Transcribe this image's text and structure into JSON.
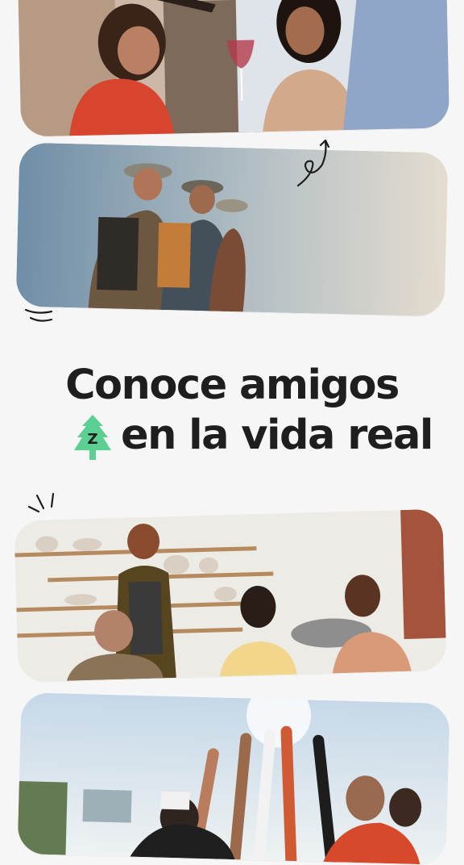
{
  "headline": {
    "line1": "Conoce amigos",
    "line2": "en la vida real",
    "icon": "tree-icon",
    "icon_letter": "Z"
  },
  "colors": {
    "background": "#f6f6f6",
    "text": "#1e1e1e",
    "tree": "#5ccf93"
  },
  "photos": [
    {
      "name": "friends-toasting-wine-photo"
    },
    {
      "name": "hikers-on-cliff-photo"
    },
    {
      "name": "pottery-workshop-photo"
    },
    {
      "name": "group-high-five-photo"
    }
  ]
}
